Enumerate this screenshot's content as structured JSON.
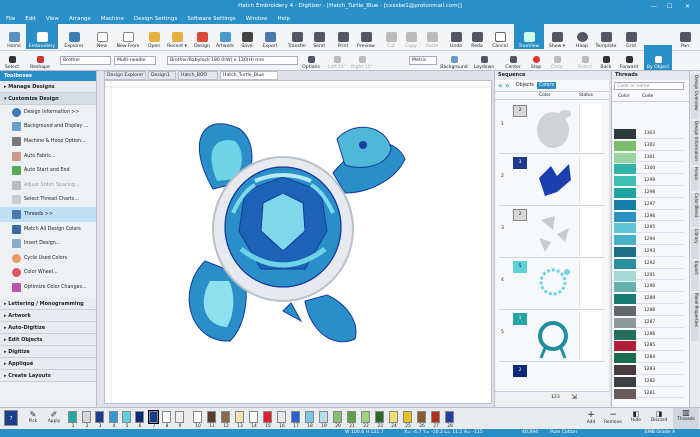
{
  "window": {
    "title": "Hatch Embroidery 4 - Digitizer - [Hatch_Turtle_Blue - [cxxsbe1@protonmail.com]]",
    "minimize": "—",
    "maximize": "☐",
    "close": "✕"
  },
  "menu": [
    "File",
    "Edit",
    "View",
    "Arrange",
    "Machine",
    "Design Settings",
    "Software Settings",
    "Window",
    "Help"
  ],
  "toolbar": [
    {
      "id": "home",
      "label": "Home"
    },
    {
      "id": "embroidery",
      "label": "Embroidery"
    },
    {
      "id": "explorer",
      "label": "Explorer"
    },
    {
      "id": "new",
      "label": "New"
    },
    {
      "id": "new-from",
      "label": "New From"
    },
    {
      "id": "open",
      "label": "Open"
    },
    {
      "id": "recent",
      "label": "Recent ▾"
    },
    {
      "id": "design",
      "label": "Design"
    },
    {
      "id": "artwork",
      "label": "Artwork"
    },
    {
      "id": "save",
      "label": "Save"
    },
    {
      "id": "export",
      "label": "Export"
    },
    {
      "id": "transfer",
      "label": "Transfer"
    },
    {
      "id": "send",
      "label": "Send"
    },
    {
      "id": "print",
      "label": "Print"
    },
    {
      "id": "preview",
      "label": "Preview"
    },
    {
      "id": "cut",
      "label": "Cut"
    },
    {
      "id": "copy",
      "label": "Copy"
    },
    {
      "id": "paste",
      "label": "Paste"
    },
    {
      "id": "undo",
      "label": "Undo"
    },
    {
      "id": "redo",
      "label": "Redo"
    },
    {
      "id": "cancel",
      "label": "Cancel"
    },
    {
      "id": "trueview",
      "label": "TrueView"
    },
    {
      "id": "show",
      "label": "Show ▾"
    },
    {
      "id": "hoop",
      "label": "Hoop"
    },
    {
      "id": "template",
      "label": "Template"
    },
    {
      "id": "grid",
      "label": "Grid"
    },
    {
      "id": "pan",
      "label": "Pan"
    }
  ],
  "toolbar2": {
    "select": "Select",
    "reshape": "Reshape",
    "fabric": "Brother",
    "needle": "Multi-needle",
    "hoop": "Brother/Babylock 180.0(W) x 130(H) mm",
    "options": "Options",
    "left15": "Left 15°",
    "right15": "Right 15°",
    "units": "Metric",
    "background": "Background",
    "laydown": "Laydown",
    "center": "Center",
    "stop": "Stop",
    "clear": "Clear",
    "select2": "Select",
    "back": "Back",
    "forward": "Forward",
    "by_object": "By Object"
  },
  "toolboxes": {
    "title": "Toolboxes",
    "sections": [
      "Manage Designs",
      "Customize Design",
      "Lettering / Monogramming",
      "Artwork",
      "Auto-Digitize",
      "Edit Objects",
      "Digitize",
      "Appliqué",
      "Create Layouts"
    ],
    "items": [
      "Design Information >>",
      "Background and Display ...",
      "Machine & Hoop Option...",
      "Auto Fabric...",
      "Auto Start and End",
      "Adjust Stitch Spacing...",
      "Select Thread Charts...",
      "Threads >>",
      "Match All Design Colors",
      "Insert Design...",
      "Cycle Used Colors",
      "Color Wheel...",
      "Optimize Color Changes..."
    ]
  },
  "doc_tabs": [
    "Design Explorer",
    "Design1",
    "Hatch_BOO",
    "Hatch_Turtle_Blue"
  ],
  "sequence": {
    "title": "Sequence",
    "tab_objects": "Objects",
    "tab_colors": "Colors",
    "col_color": "Color",
    "col_status": "Status",
    "rows": [
      {
        "num": "1",
        "code": "2"
      },
      {
        "num": "2",
        "code": "3"
      },
      {
        "num": "3",
        "code": "2"
      },
      {
        "num": "4",
        "code": "5"
      },
      {
        "num": "5",
        "code": "1"
      },
      {
        "num": "",
        "code": "2"
      }
    ],
    "page": "123"
  },
  "threads": {
    "title": "Threads",
    "search_placeholder": "Code or name",
    "col_color": "Color",
    "col_code": "Code",
    "rows": [
      {
        "code": "1303",
        "color": "#2f3a3a"
      },
      {
        "code": "1302",
        "color": "#7bbf6e"
      },
      {
        "code": "1301",
        "color": "#9bd6a0"
      },
      {
        "code": "1300",
        "color": "#2fb4a6"
      },
      {
        "code": "1299",
        "color": "#3fbfb4"
      },
      {
        "code": "1298",
        "color": "#1fa5a0"
      },
      {
        "code": "1297",
        "color": "#147ea8"
      },
      {
        "code": "1296",
        "color": "#2a93c0"
      },
      {
        "code": "1295",
        "color": "#5fc6d8"
      },
      {
        "code": "1294",
        "color": "#46b0c6"
      },
      {
        "code": "1293",
        "color": "#1f6f88"
      },
      {
        "code": "1292",
        "color": "#2c8f9e"
      },
      {
        "code": "1291",
        "color": "#a7d8d8"
      },
      {
        "code": "1290",
        "color": "#66b0b0"
      },
      {
        "code": "1289",
        "color": "#1a7a70"
      },
      {
        "code": "1288",
        "color": "#606a6a"
      },
      {
        "code": "1287",
        "color": "#8a9a96"
      },
      {
        "code": "1286",
        "color": "#226f5a"
      },
      {
        "code": "1285",
        "color": "#b01f3a"
      },
      {
        "code": "1284",
        "color": "#1a6d50"
      },
      {
        "code": "1283",
        "color": "#4a3a3a"
      },
      {
        "code": "1282",
        "color": "#3a4044"
      },
      {
        "code": "1281",
        "color": "#6b5a5a"
      }
    ]
  },
  "right_strip": [
    "Design Overview",
    "Design Information",
    "Hoops",
    "Color Blend",
    "Library",
    "Export",
    "Panel Properties"
  ],
  "palette": [
    {
      "num": "7",
      "color": "#1b3f8f"
    },
    {
      "num": "1",
      "color": "#26a5a5"
    },
    {
      "num": "2",
      "color": "#d8d8d8"
    },
    {
      "num": "3",
      "color": "#1f3a8a"
    },
    {
      "num": "4",
      "color": "#2e9ad0"
    },
    {
      "num": "5",
      "color": "#5ed0d8"
    },
    {
      "num": "6",
      "color": "#0d2a7a"
    },
    {
      "num": "7",
      "color": "#1b3f8f"
    },
    {
      "num": "8",
      "color": "#ffffff"
    },
    {
      "num": "9",
      "color": "#f0f0f0"
    },
    {
      "num": "10",
      "color": "#ffffff"
    },
    {
      "num": "11",
      "color": "#5a3a2a"
    },
    {
      "num": "12",
      "color": "#8a6a4a"
    },
    {
      "num": "13",
      "color": "#f5e0b0"
    },
    {
      "num": "14",
      "color": "#ffffff"
    },
    {
      "num": "15",
      "color": "#e02030"
    },
    {
      "num": "16",
      "color": "#e8e8e8"
    },
    {
      "num": "17",
      "color": "#2a60d0"
    },
    {
      "num": "18",
      "color": "#7ac8e8"
    },
    {
      "num": "19",
      "color": "#b8e0e8"
    },
    {
      "num": "20",
      "color": "#88c070"
    },
    {
      "num": "21",
      "color": "#60a040"
    },
    {
      "num": "22",
      "color": "#a0d080"
    },
    {
      "num": "23",
      "color": "#2a6a30"
    },
    {
      "num": "24",
      "color": "#f0e070"
    },
    {
      "num": "25",
      "color": "#e8c020"
    },
    {
      "num": "26",
      "color": "#8a5a30"
    },
    {
      "num": "27",
      "color": "#b03020"
    },
    {
      "num": "28",
      "color": "#2040a0"
    }
  ],
  "bottom_tools": {
    "pick": "Pick",
    "apply": "Apply",
    "add": "Add",
    "remove": "Remove",
    "hide": "Hide",
    "discard": "Discard",
    "threads": "Threads"
  },
  "status": {
    "size": "W 100.6 H 121.7",
    "coords": "X= -4.7 Y= -10.2 L= 11.2 A= -115",
    "stitches": "40,894",
    "fabric": "Pure Cotton",
    "grade": "EMB Grade A"
  },
  "accent": "#2b8fc7"
}
